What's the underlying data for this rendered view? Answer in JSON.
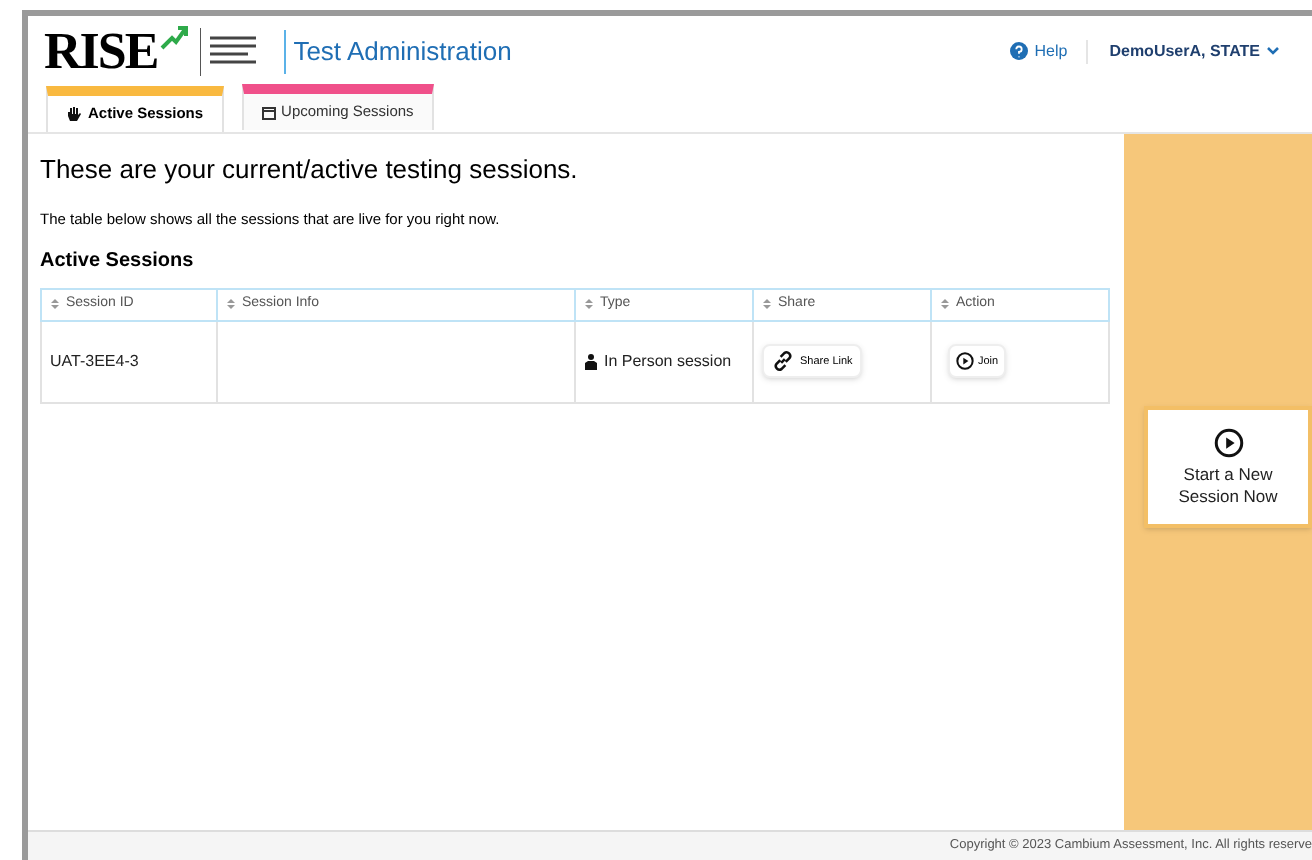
{
  "header": {
    "logo": "RISE",
    "title": "Test Administration",
    "help": "Help",
    "user": "DemoUserA, STATE"
  },
  "tabs": [
    {
      "label": "Active Sessions",
      "selected": true,
      "color": "#f9b940"
    },
    {
      "label": "Upcoming Sessions",
      "selected": false,
      "color": "#f0508a"
    }
  ],
  "heading": "These are your current/active testing sessions.",
  "intro": "The table below shows all the sessions that are live for you right now.",
  "section_title": "Active Sessions",
  "table": {
    "columns": [
      "Session ID",
      "Session Info",
      "Type",
      "Share",
      "Action"
    ],
    "rows": [
      {
        "session_id": "UAT-3EE4-3",
        "session_info": "",
        "type": "In Person session",
        "share": "Share Link",
        "action": "Join"
      }
    ]
  },
  "new_session_button": "Start a New Session Now",
  "footer": "Copyright © 2023 Cambium Assessment, Inc. All rights reserve"
}
